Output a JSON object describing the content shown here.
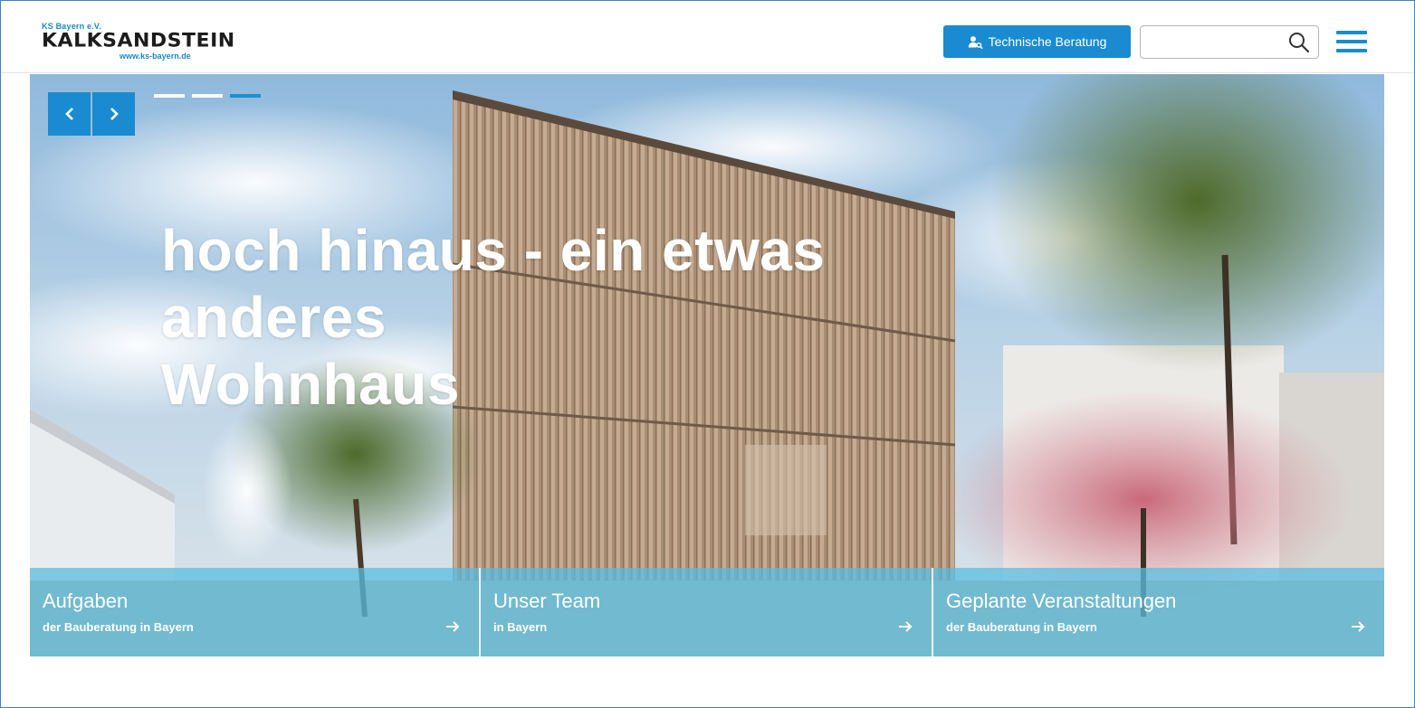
{
  "header": {
    "logo": {
      "small_text": "KS Bayern e.V.",
      "name": "KALKSANDSTEIN",
      "url": "www.ks-bayern.de"
    },
    "beratung_label": "Technische Beratung",
    "search": {
      "placeholder": "",
      "value": ""
    }
  },
  "hero": {
    "headline_line1": "hoch hinaus - ein etwas anderes",
    "headline_line2": "Wohnhaus",
    "slides_total": 3,
    "active_slide": 3
  },
  "tiles": [
    {
      "title": "Aufgaben",
      "subtitle": "der Bauberatung in Bayern"
    },
    {
      "title": "Unser Team",
      "subtitle": "in Bayern"
    },
    {
      "title": "Geplante Veranstaltungen",
      "subtitle": "der Bauberatung in Bayern"
    }
  ],
  "colors": {
    "accent": "#1a8bd0",
    "tile": "#5abce0"
  },
  "icons": {
    "beratung": "user-search-icon",
    "search": "search-icon",
    "menu": "hamburger-menu-icon",
    "prev": "chevron-left-icon",
    "next": "chevron-right-icon",
    "tile_arrow": "arrow-right-icon"
  }
}
